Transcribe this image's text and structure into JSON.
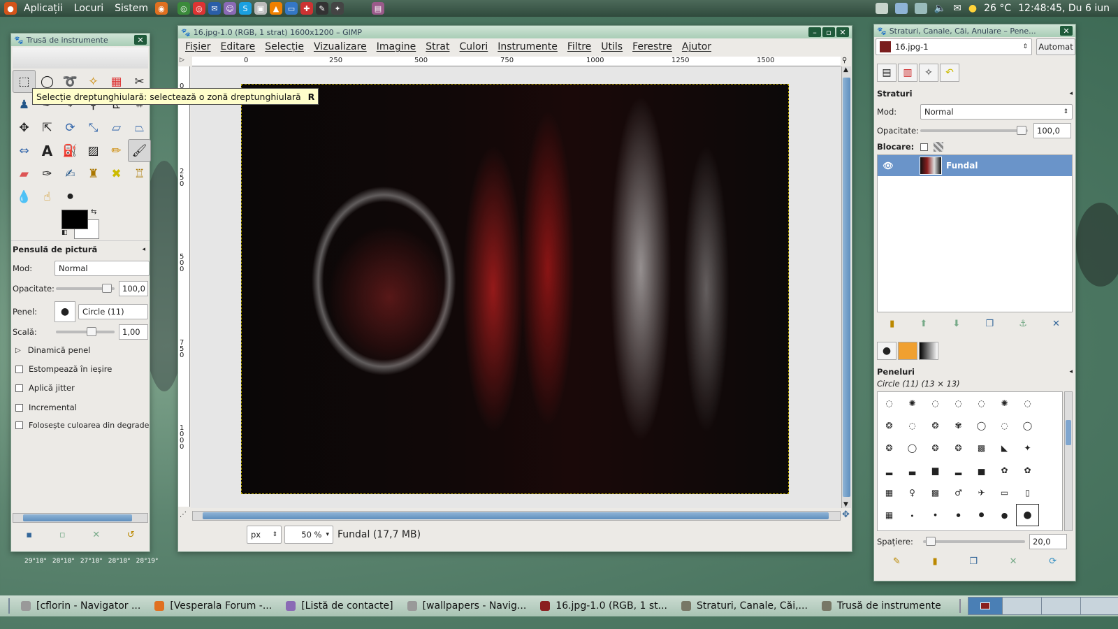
{
  "top_panel": {
    "menus": [
      "Aplicații",
      "Locuri",
      "Sistem"
    ],
    "temperature": "26 °C",
    "clock": "12:48:45, Du  6 iun"
  },
  "toolbox": {
    "title": "Trusă de instrumente",
    "tool_options_title": "Pensulă de pictură",
    "mode_label": "Mod:",
    "mode_value": "Normal",
    "opacity_label": "Opacitate:",
    "opacity_value": "100,0",
    "opacity_fraction": 1.0,
    "brush_label": "Penel:",
    "brush_value": "Circle (11)",
    "scale_label": "Scală:",
    "scale_value": "1,00",
    "dynamics_label": "Dinamică penel",
    "fade_label": "Estompează în ieșire",
    "jitter_label": "Aplică jitter",
    "incremental_label": "Incremental",
    "gradient_label": "Folosește culoarea din degrade",
    "weather": [
      "29°18°",
      "28°18°",
      "27°18°",
      "28°18°",
      "28°19°"
    ]
  },
  "tooltip": {
    "text": "Selecție dreptunghiulară: selectează o zonă dreptunghiulară",
    "shortcut": "R"
  },
  "gimp": {
    "title": "16.jpg-1.0 (RGB, 1 strat) 1600x1200 – GIMP",
    "menu": [
      "Fișier",
      "Editare",
      "Selecție",
      "Vizualizare",
      "Imagine",
      "Strat",
      "Culori",
      "Instrumente",
      "Filtre",
      "Utils",
      "Ferestre",
      "Ajutor"
    ],
    "ruler_top": [
      "0",
      "250",
      "500",
      "750",
      "1000",
      "1250",
      "1500"
    ],
    "ruler_left": [
      "0",
      "250",
      "500",
      "750",
      "1000"
    ],
    "unit": "px",
    "zoom": "50 %",
    "status_text": "Fundal (17,7 MB)"
  },
  "dock": {
    "title": "Straturi, Canale, Căi, Anulare – Pene...",
    "image_select": "16.jpg-1",
    "auto_button": "Automat",
    "layers_title": "Straturi",
    "mode_label": "Mod:",
    "mode_value": "Normal",
    "opacity_label": "Opacitate:",
    "opacity_value": "100,0",
    "lock_label": "Blocare:",
    "layer_name": "Fundal",
    "brushes_title": "Peneluri",
    "brush_current": "Circle (11) (13 × 13)",
    "spacing_label": "Spațiere:",
    "spacing_value": "20,0"
  },
  "taskbar": {
    "tasks": [
      "[cflorin - Navigator ...",
      "[Vesperala Forum -...",
      "[Listă de contacte]",
      "[wallpapers - Navig...",
      "16.jpg-1.0 (RGB, 1 st...",
      "Straturi, Canale, Căi,...",
      "Trusă de instrumente"
    ]
  },
  "colors": {
    "accent": "#6a94c9",
    "titlebar": "#a9cdb6",
    "panel": "#2f4a3c"
  }
}
